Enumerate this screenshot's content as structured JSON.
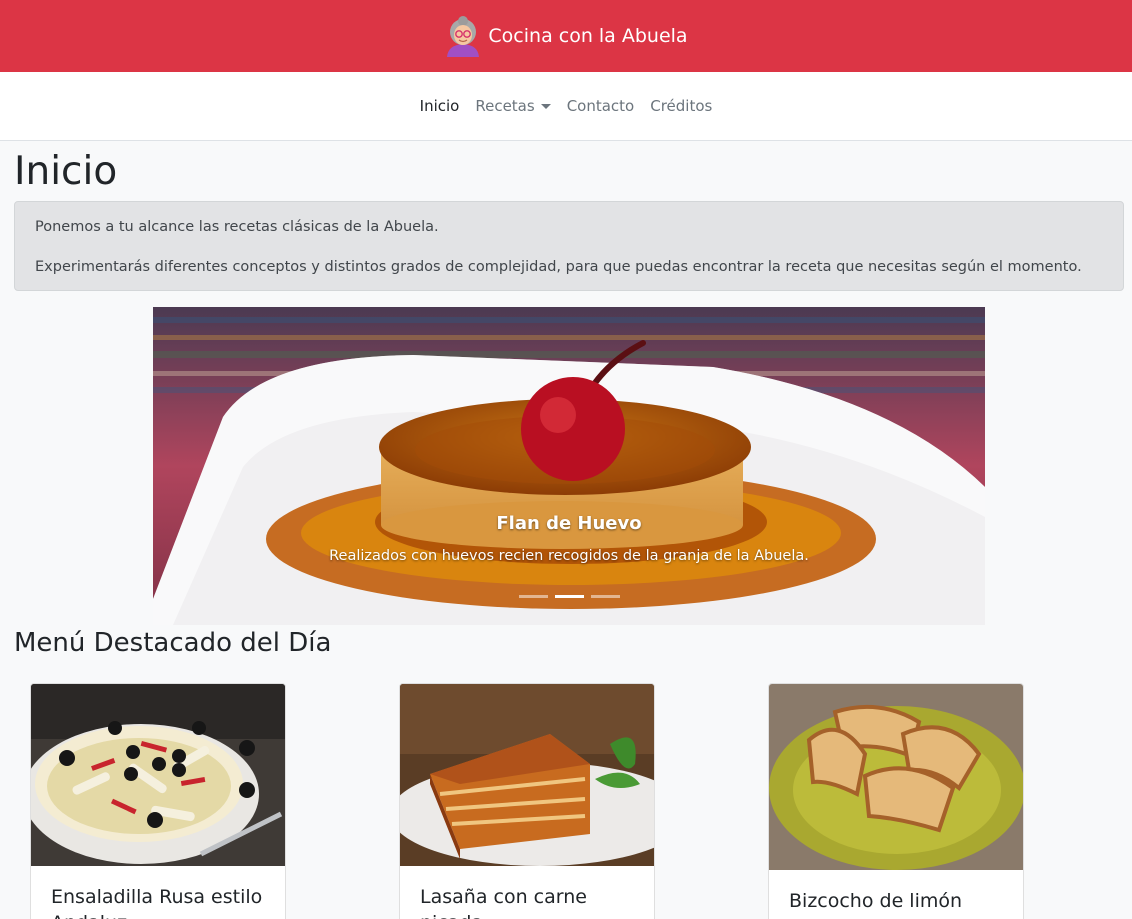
{
  "header": {
    "brand": "Cocina con la Abuela",
    "brand_icon": "grandma-avatar-icon",
    "bg_color": "#dc3545"
  },
  "nav": {
    "items": [
      {
        "label": "Inicio",
        "active": true
      },
      {
        "label": "Recetas",
        "dropdown": true
      },
      {
        "label": "Contacto"
      },
      {
        "label": "Créditos"
      }
    ]
  },
  "page": {
    "title": "Inicio",
    "intro": [
      "Ponemos a tu alcance las recetas clásicas de la Abuela.",
      "Experimentarás diferentes conceptos y distintos grados de complejidad, para que puedas encontrar la receta que necesitas según el momento."
    ]
  },
  "carousel": {
    "title": "Flan de Huevo",
    "text": "Realizados con huevos recien recogidos de la granja de la Abuela.",
    "slides": 3,
    "active_slide": 2
  },
  "featured": {
    "title": "Menú Destacado del Día",
    "cards": [
      {
        "title": "Ensaladilla Rusa estilo Andaluz"
      },
      {
        "title": "Lasaña con carne picada"
      },
      {
        "title": "Bizcocho de limón"
      }
    ]
  }
}
